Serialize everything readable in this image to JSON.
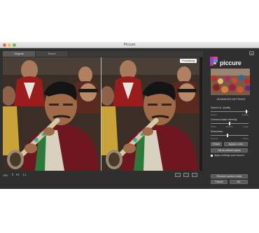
{
  "window": {
    "title": "Piccure"
  },
  "tabs": [
    {
      "label": "Original",
      "active": true
    },
    {
      "label": "Result",
      "active": false
    }
  ],
  "viewer": {
    "badge": "Processing"
  },
  "bottombar": {
    "zoom": "100",
    "fit_label": "Fit",
    "one_to_one_label": "1:1"
  },
  "panel": {
    "brand": "piccure",
    "advanced_header": "ADVANCED SETTINGS",
    "speed_quality": {
      "label": "Speed vs. Quality",
      "left": "Speed",
      "right": "Quality",
      "value": 0.97
    },
    "camera_shake": {
      "label": "Camera shake intensity",
      "ticks": [
        "Weak",
        "Medium",
        "Large"
      ],
      "value": 0.5
    },
    "sharpness": {
      "label": "Sharpness",
      "left": "Smooth",
      "right": "Sharp",
      "value": 0.45
    },
    "reset_label": "Reset",
    "apply_label": "Apply to view",
    "default_label": "Set as default values",
    "auto_apply_label": "Apply settings upon launch",
    "remove_shake_label": "Remove camera shake",
    "cancel_label": "Cancel",
    "ok_label": "OK"
  },
  "colors": {
    "background": "#2f2f2f",
    "accent_logo": "#9b3fc6"
  }
}
